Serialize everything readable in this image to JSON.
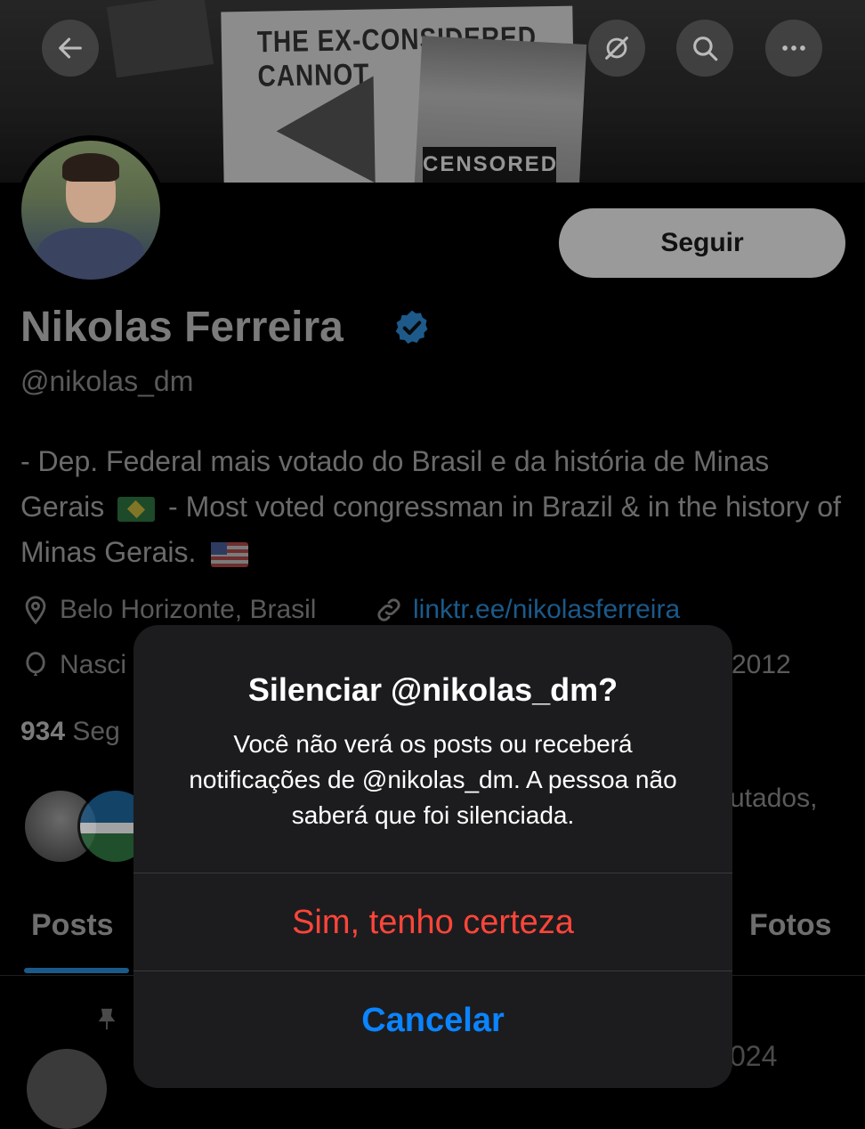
{
  "header": {
    "banner_sign_text": "THE EX-CONSIDERED CANNOT",
    "banner_censored_text": "CENSORED"
  },
  "profile": {
    "follow_label": "Seguir",
    "name": "Nikolas Ferreira",
    "handle": "@nikolas_dm",
    "bio_part1": "- Dep. Federal mais votado do Brasil e da história de Minas Gerais",
    "bio_part2": "- Most voted congressman in Brazil & in the history of Minas Gerais.",
    "location": "Belo Horizonte, Brasil",
    "link": "linktr.ee/nikolasferreira",
    "birth_partial": "Nasci",
    "join_partial": "2012",
    "following_count": "934",
    "following_partial": "Seg",
    "mutuals_partial": "utados,"
  },
  "tabs": {
    "posts": "Posts",
    "photos": "Fotos"
  },
  "post": {
    "date_partial": "024"
  },
  "alert": {
    "title": "Silenciar @nikolas_dm?",
    "message": "Você não verá os posts ou receberá notificações de @nikolas_dm. A pessoa não saberá que foi silenciada.",
    "confirm_label": "Sim, tenho certeza",
    "cancel_label": "Cancelar"
  },
  "colors": {
    "destructive": "#ff453a",
    "cancel": "#0a84ff",
    "verified": "#1d9bf0"
  }
}
